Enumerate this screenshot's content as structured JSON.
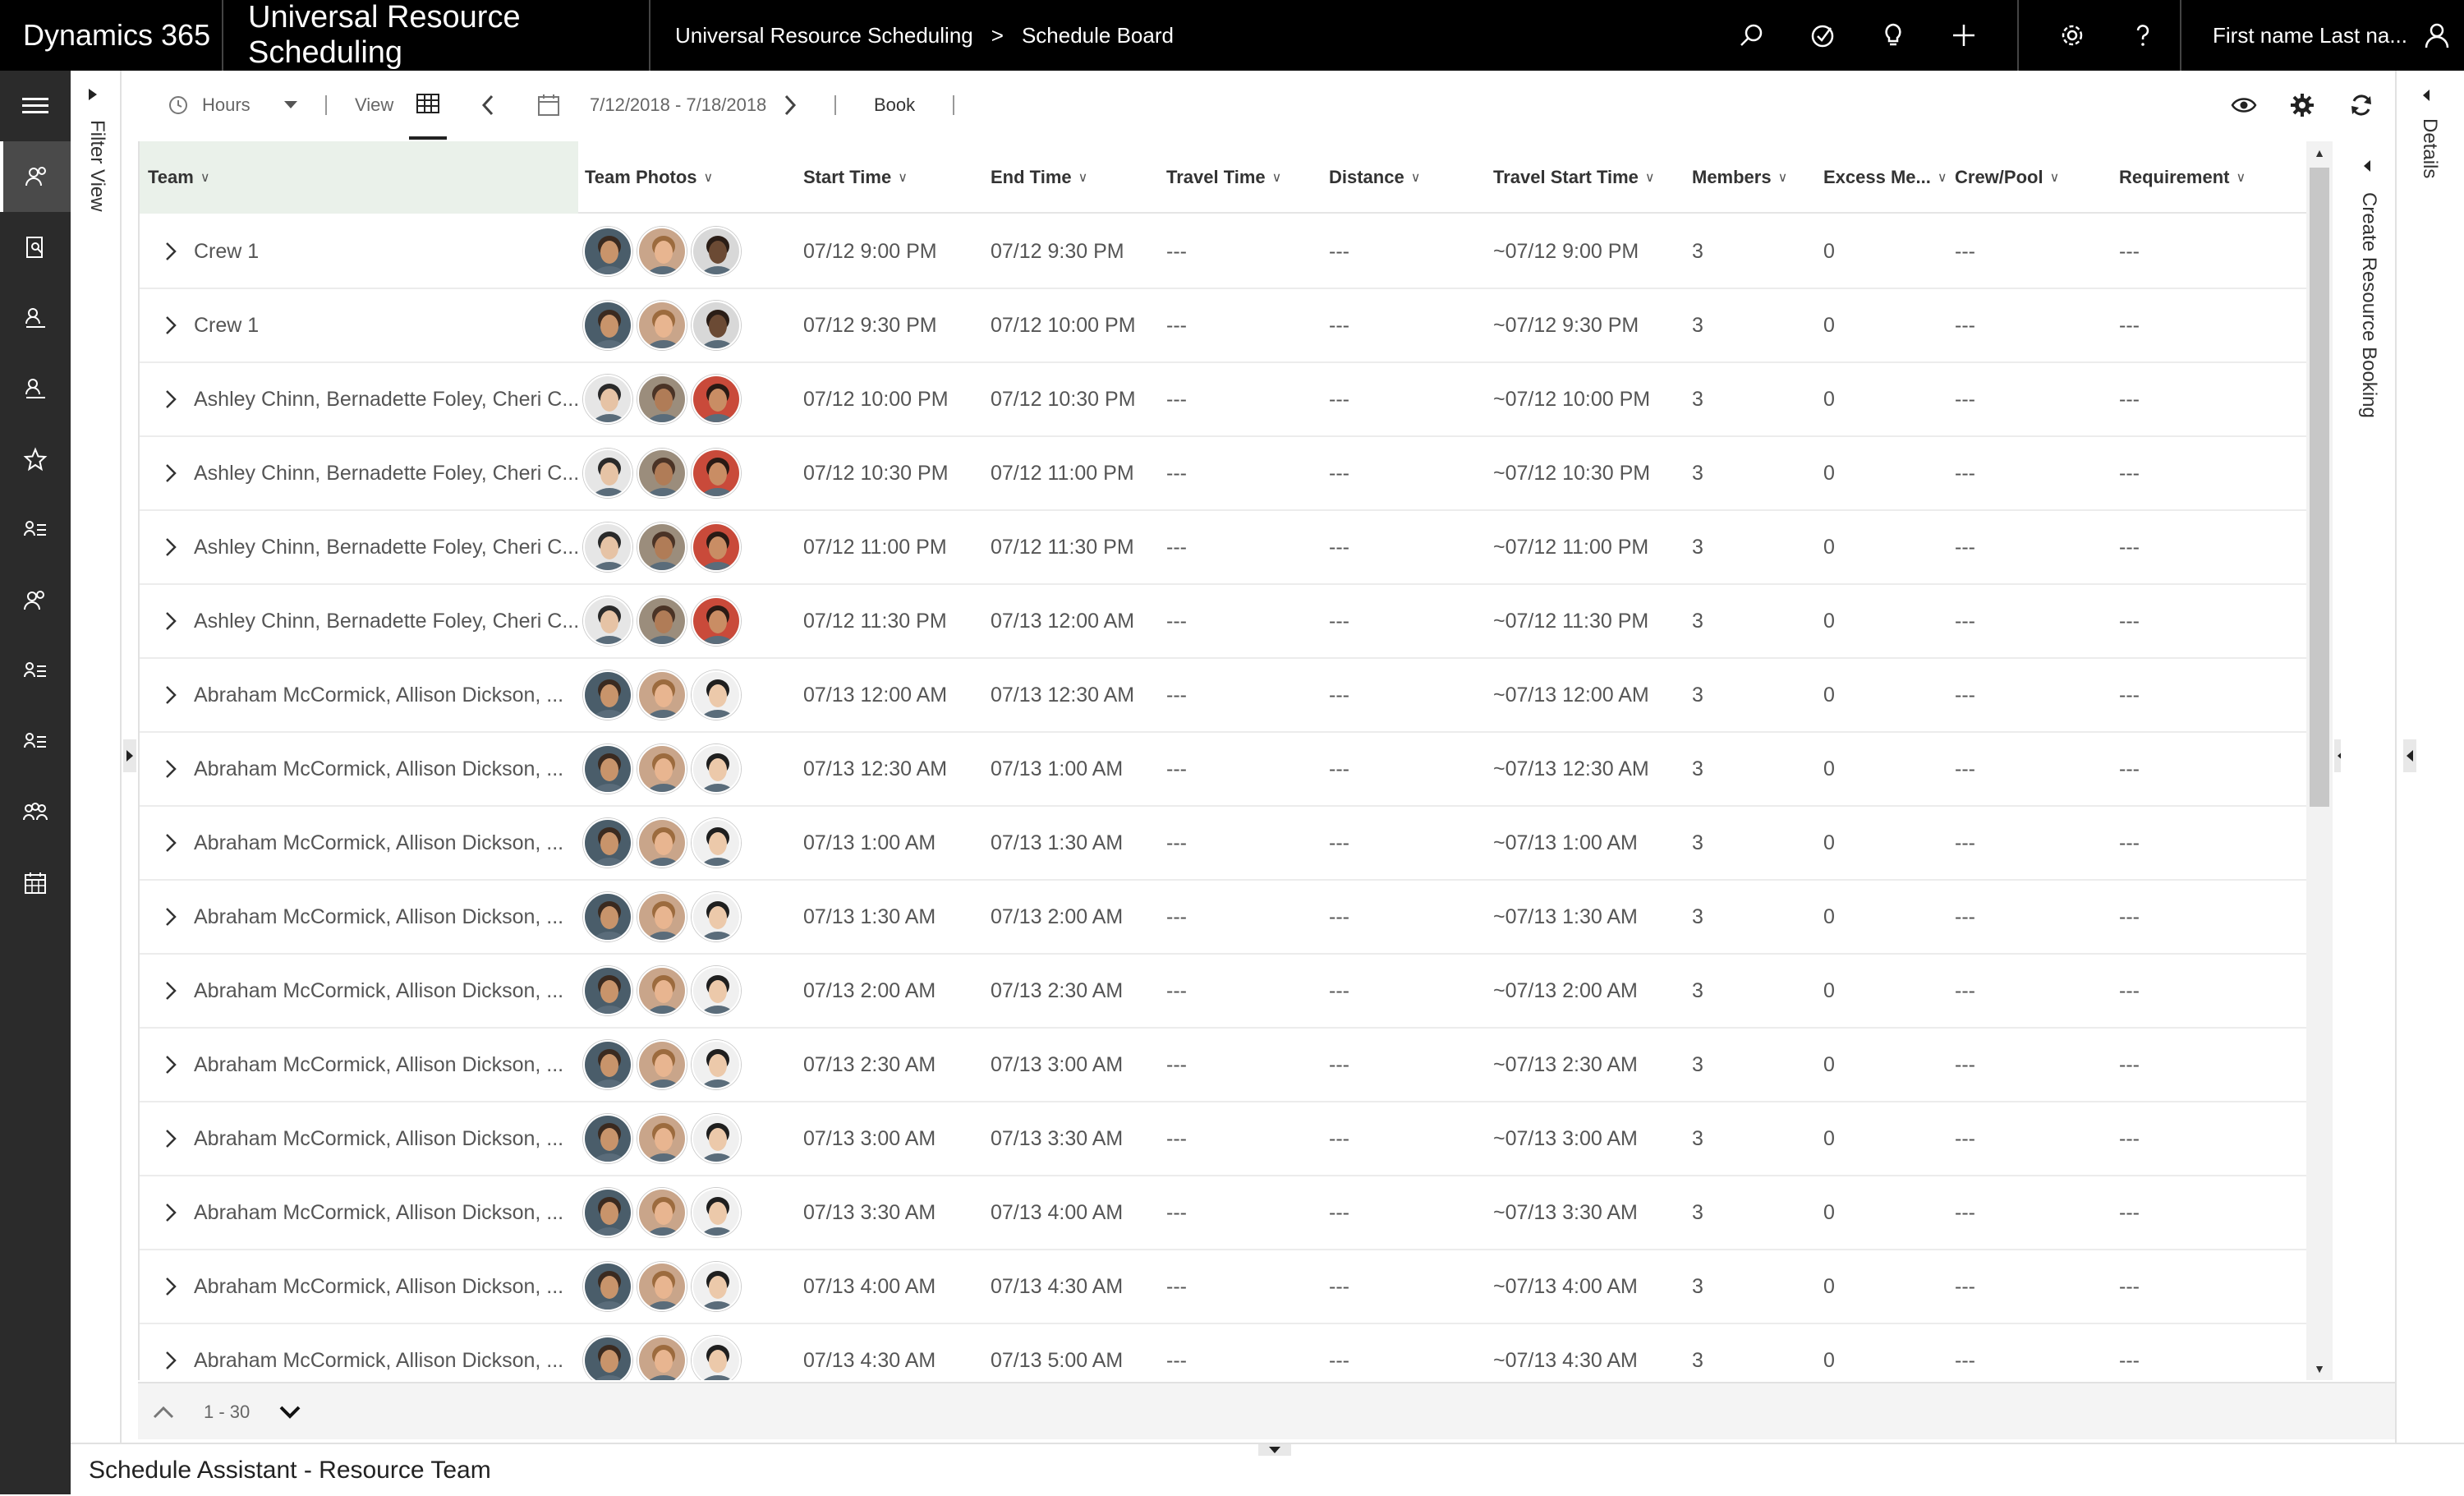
{
  "topbar": {
    "brand": "Dynamics 365",
    "app_name": "Universal Resource Scheduling",
    "breadcrumb_1": "Universal Resource Scheduling",
    "breadcrumb_sep": ">",
    "breadcrumb_2": "Schedule Board",
    "user_name": "First name Last na..."
  },
  "filter_strip": {
    "label": "Filter View"
  },
  "toolbar": {
    "hours_label": "Hours",
    "view_label": "View",
    "date_range": "7/12/2018 - 7/18/2018",
    "book_label": "Book"
  },
  "grid": {
    "columns": {
      "team": "Team",
      "photos": "Team Photos",
      "start": "Start Time",
      "end": "End Time",
      "travel_time": "Travel Time",
      "distance": "Distance",
      "travel_start": "Travel Start Time",
      "members": "Members",
      "excess": "Excess Me...",
      "crew": "Crew/Pool",
      "requirement": "Requirement"
    },
    "rows": [
      {
        "team": "Crew 1",
        "start": "07/12 9:00 PM",
        "end": "07/12 9:30 PM",
        "travel_time": "---",
        "distance": "---",
        "travel_start": "~07/12 9:00 PM",
        "members": "3",
        "excess": "0",
        "crew": "---",
        "requirement": "---",
        "photos": [
          "a",
          "b",
          "c"
        ]
      },
      {
        "team": "Crew 1",
        "start": "07/12 9:30 PM",
        "end": "07/12 10:00 PM",
        "travel_time": "---",
        "distance": "---",
        "travel_start": "~07/12 9:30 PM",
        "members": "3",
        "excess": "0",
        "crew": "---",
        "requirement": "---",
        "photos": [
          "a",
          "b",
          "c"
        ]
      },
      {
        "team": "Ashley Chinn, Bernadette Foley, Cheri C...",
        "start": "07/12 10:00 PM",
        "end": "07/12 10:30 PM",
        "travel_time": "---",
        "distance": "---",
        "travel_start": "~07/12 10:00 PM",
        "members": "3",
        "excess": "0",
        "crew": "---",
        "requirement": "---",
        "photos": [
          "d",
          "e",
          "f"
        ]
      },
      {
        "team": "Ashley Chinn, Bernadette Foley, Cheri C...",
        "start": "07/12 10:30 PM",
        "end": "07/12 11:00 PM",
        "travel_time": "---",
        "distance": "---",
        "travel_start": "~07/12 10:30 PM",
        "members": "3",
        "excess": "0",
        "crew": "---",
        "requirement": "---",
        "photos": [
          "d",
          "e",
          "f"
        ]
      },
      {
        "team": "Ashley Chinn, Bernadette Foley, Cheri C...",
        "start": "07/12 11:00 PM",
        "end": "07/12 11:30 PM",
        "travel_time": "---",
        "distance": "---",
        "travel_start": "~07/12 11:00 PM",
        "members": "3",
        "excess": "0",
        "crew": "---",
        "requirement": "---",
        "photos": [
          "d",
          "e",
          "f"
        ]
      },
      {
        "team": "Ashley Chinn, Bernadette Foley, Cheri C...",
        "start": "07/12 11:30 PM",
        "end": "07/13 12:00 AM",
        "travel_time": "---",
        "distance": "---",
        "travel_start": "~07/12 11:30 PM",
        "members": "3",
        "excess": "0",
        "crew": "---",
        "requirement": "---",
        "photos": [
          "d",
          "e",
          "f"
        ]
      },
      {
        "team": "Abraham McCormick, Allison Dickson, ...",
        "start": "07/13 12:00 AM",
        "end": "07/13 12:30 AM",
        "travel_time": "---",
        "distance": "---",
        "travel_start": "~07/13 12:00 AM",
        "members": "3",
        "excess": "0",
        "crew": "---",
        "requirement": "---",
        "photos": [
          "a",
          "b",
          "g"
        ]
      },
      {
        "team": "Abraham McCormick, Allison Dickson, ...",
        "start": "07/13 12:30 AM",
        "end": "07/13 1:00 AM",
        "travel_time": "---",
        "distance": "---",
        "travel_start": "~07/13 12:30 AM",
        "members": "3",
        "excess": "0",
        "crew": "---",
        "requirement": "---",
        "photos": [
          "a",
          "b",
          "g"
        ]
      },
      {
        "team": "Abraham McCormick, Allison Dickson, ...",
        "start": "07/13 1:00 AM",
        "end": "07/13 1:30 AM",
        "travel_time": "---",
        "distance": "---",
        "travel_start": "~07/13 1:00 AM",
        "members": "3",
        "excess": "0",
        "crew": "---",
        "requirement": "---",
        "photos": [
          "a",
          "b",
          "g"
        ]
      },
      {
        "team": "Abraham McCormick, Allison Dickson, ...",
        "start": "07/13 1:30 AM",
        "end": "07/13 2:00 AM",
        "travel_time": "---",
        "distance": "---",
        "travel_start": "~07/13 1:30 AM",
        "members": "3",
        "excess": "0",
        "crew": "---",
        "requirement": "---",
        "photos": [
          "a",
          "b",
          "g"
        ]
      },
      {
        "team": "Abraham McCormick, Allison Dickson, ...",
        "start": "07/13 2:00 AM",
        "end": "07/13 2:30 AM",
        "travel_time": "---",
        "distance": "---",
        "travel_start": "~07/13 2:00 AM",
        "members": "3",
        "excess": "0",
        "crew": "---",
        "requirement": "---",
        "photos": [
          "a",
          "b",
          "g"
        ]
      },
      {
        "team": "Abraham McCormick, Allison Dickson, ...",
        "start": "07/13 2:30 AM",
        "end": "07/13 3:00 AM",
        "travel_time": "---",
        "distance": "---",
        "travel_start": "~07/13 2:30 AM",
        "members": "3",
        "excess": "0",
        "crew": "---",
        "requirement": "---",
        "photos": [
          "a",
          "b",
          "g"
        ]
      },
      {
        "team": "Abraham McCormick, Allison Dickson, ...",
        "start": "07/13 3:00 AM",
        "end": "07/13 3:30 AM",
        "travel_time": "---",
        "distance": "---",
        "travel_start": "~07/13 3:00 AM",
        "members": "3",
        "excess": "0",
        "crew": "---",
        "requirement": "---",
        "photos": [
          "a",
          "b",
          "g"
        ]
      },
      {
        "team": "Abraham McCormick, Allison Dickson, ...",
        "start": "07/13 3:30 AM",
        "end": "07/13 4:00 AM",
        "travel_time": "---",
        "distance": "---",
        "travel_start": "~07/13 3:30 AM",
        "members": "3",
        "excess": "0",
        "crew": "---",
        "requirement": "---",
        "photos": [
          "a",
          "b",
          "g"
        ]
      },
      {
        "team": "Abraham McCormick, Allison Dickson, ...",
        "start": "07/13 4:00 AM",
        "end": "07/13 4:30 AM",
        "travel_time": "---",
        "distance": "---",
        "travel_start": "~07/13 4:00 AM",
        "members": "3",
        "excess": "0",
        "crew": "---",
        "requirement": "---",
        "photos": [
          "a",
          "b",
          "g"
        ]
      },
      {
        "team": "Abraham McCormick, Allison Dickson, ...",
        "start": "07/13 4:30 AM",
        "end": "07/13 5:00 AM",
        "travel_time": "---",
        "distance": "---",
        "travel_start": "~07/13 4:30 AM",
        "members": "3",
        "excess": "0",
        "crew": "---",
        "requirement": "---",
        "photos": [
          "a",
          "b",
          "g"
        ]
      }
    ]
  },
  "avatar_colors": {
    "a": {
      "skin": "#c8946b",
      "hair": "#3a2a20",
      "bg": "#4a5d6a"
    },
    "b": {
      "skin": "#e8b590",
      "hair": "#9c6b3e",
      "bg": "#c9a58a"
    },
    "c": {
      "skin": "#6b4a34",
      "hair": "#2a1d16",
      "bg": "#d8d8d8"
    },
    "d": {
      "skin": "#e6c3a5",
      "hair": "#2a2a2a",
      "bg": "#e6e6e6"
    },
    "e": {
      "skin": "#b07c57",
      "hair": "#4a3326",
      "bg": "#9b8d7c"
    },
    "f": {
      "skin": "#c98d64",
      "hair": "#2a1a14",
      "bg": "#c94a3a"
    },
    "g": {
      "skin": "#ecc9aa",
      "hair": "#1f1f1f",
      "bg": "#f0f0f0"
    }
  },
  "create_strip": {
    "label": "Create Resource Booking"
  },
  "details_strip": {
    "label": "Details"
  },
  "pager": {
    "range": "1 - 30"
  },
  "bottom": {
    "title": "Schedule Assistant - Resource Team"
  }
}
